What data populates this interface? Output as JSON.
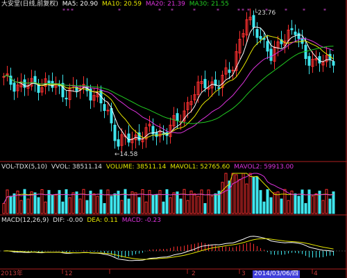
{
  "colors": {
    "up": "#ff3030",
    "down": "#3fe6ee",
    "ma5": "#ffffff",
    "ma10": "#e8e800",
    "ma20": "#dd33dd",
    "ma30": "#22cc22",
    "axis": "#b02020",
    "accent_date": "#3f3fd9"
  },
  "main_info": {
    "name": "大安堂(日线,前复权)",
    "ma5": "MA5: 20.90",
    "ma10": "MA10: 20.59",
    "ma20": "MA20: 21.39",
    "ma30": "MA30: 21.55"
  },
  "vol_info": {
    "name": "VOL-TDX(5,10)",
    "vvol": "VVOL: 38511.14",
    "volume": "VOLUME: 38511.14",
    "mavol1": "MAVOL1: 52765.60",
    "mavol2": "MAVOL2: 59913.00"
  },
  "macd_info": {
    "name": "MACD(12,26,9)",
    "dif": "DIF: -0.00",
    "dea": "DEA: 0.11",
    "macd": "MACD: -0.23"
  },
  "annotations": {
    "high": "23.76",
    "low": "14.58"
  },
  "time_axis": {
    "labels": [
      "2013年",
      "12",
      "2",
      "3",
      "4"
    ],
    "selected_date": "2014/03/06/四"
  },
  "chart_data": {
    "type": "candlestick",
    "title": "",
    "high_marker": 23.76,
    "low_marker": 14.58,
    "series": [
      {
        "name": "MA5",
        "last": 20.9
      },
      {
        "name": "MA10",
        "last": 20.59
      },
      {
        "name": "MA20",
        "last": 21.39
      },
      {
        "name": "MA30",
        "last": 21.55
      }
    ],
    "volume": {
      "vvol": 38511.14,
      "volume": 38511.14,
      "mavol1": 52765.6,
      "mavol2": 59913.0
    },
    "macd": {
      "dif": -0.0,
      "dea": 0.11,
      "macd": -0.23
    }
  }
}
